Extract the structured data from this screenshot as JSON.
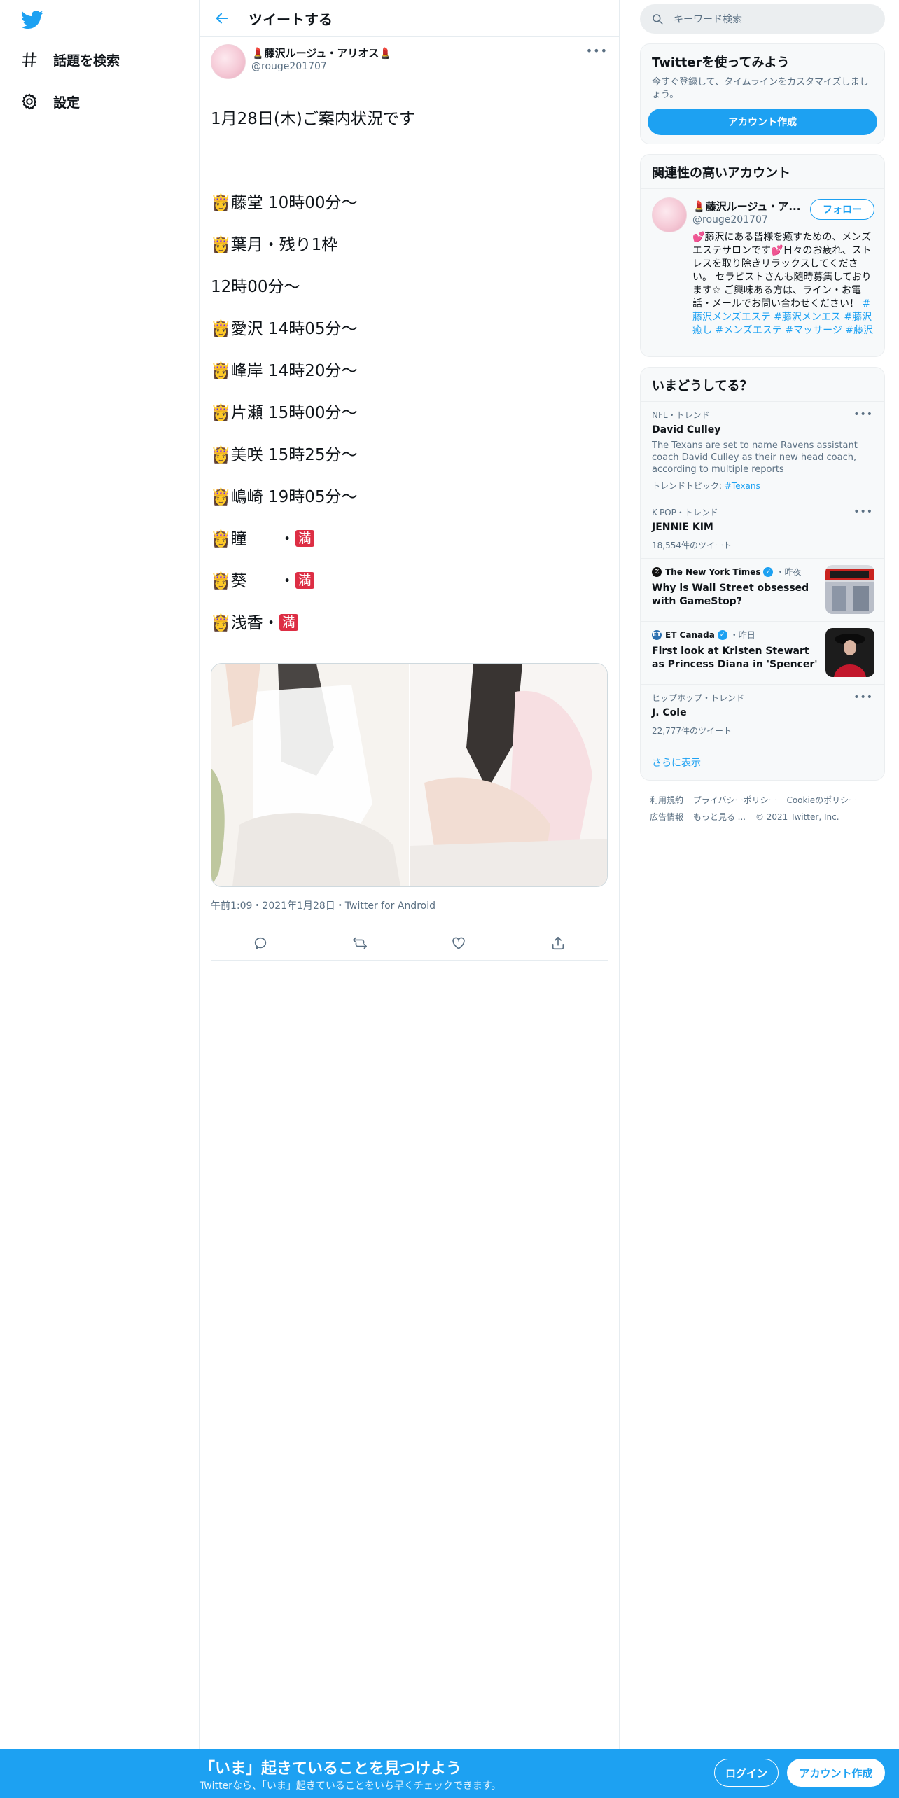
{
  "nav": {
    "items": [
      {
        "label": "話題を検索",
        "icon": "hashtag-icon"
      },
      {
        "label": "設定",
        "icon": "gear-icon"
      }
    ]
  },
  "main": {
    "title": "ツイートする"
  },
  "tweet": {
    "author_name": "💄藤沢ルージュ・アリオス💄",
    "author_handle": "@rouge201707",
    "lines": [
      "1月28日(木)ご案内状況です",
      "",
      "👸藤堂 10時00分～",
      "👸葉月・残り1枠",
      "12時00分～",
      "👸愛沢 14時05分～",
      "👸峰岸 14時20分～",
      "👸片瀬 15時00分～",
      "👸美咲 15時25分～",
      "👸嶋崎 19時05分～"
    ],
    "full_lines": [
      {
        "name": "👸瞳　　・",
        "badge": "満"
      },
      {
        "name": "👸葵　　・",
        "badge": "満"
      },
      {
        "name": "👸浅香・",
        "badge": "満"
      }
    ],
    "meta": "午前1:09・2021年1月28日・Twitter for Android"
  },
  "right": {
    "search_placeholder": "キーワード検索",
    "signup_card": {
      "title": "Twitterを使ってみよう",
      "desc": "今すぐ登録して、タイムラインをカスタマイズしましょう。",
      "button": "アカウント作成"
    },
    "related": {
      "title": "関連性の高いアカウント",
      "name": "💄藤沢ルージュ・ア...",
      "handle": "@rouge201707",
      "follow": "フォロー",
      "bio": "💕藤沢にある皆様を癒すための、メンズエステサロンです💕日々のお疲れ、ストレスを取り除きリラックスしてください。 セラピストさんも随時募集しております☆ ご興味ある方は、ライン・お電話・メールでお問い合わせください！",
      "bio_tags": "#藤沢メンズエステ #藤沢メンエス #藤沢癒し #メンズエステ #マッサージ #藤沢"
    },
    "trends": {
      "title": "いまどうしてる？",
      "nfl": {
        "context": "NFL・トレンド",
        "name": "David Culley",
        "desc": "The Texans are set to name Ravens assistant coach David Culley as their new head coach, according to multiple reports",
        "topic_label": "トレンドトピック: ",
        "topic_tag": "#Texans"
      },
      "kpop": {
        "context": "K-POP・トレンド",
        "name": "JENNIE KIM",
        "count": "18,554件のツイート"
      },
      "news1": {
        "source": "The New York Times",
        "time": "・昨夜",
        "title": "Why is Wall Street obsessed with GameStop?"
      },
      "news2": {
        "source": "ET Canada",
        "time": "・昨日",
        "title": "First look at Kristen Stewart as Princess Diana in 'Spencer'"
      },
      "hiphop": {
        "context": "ヒップホップ・トレンド",
        "name": "J. Cole",
        "count": "22,777件のツイート"
      },
      "show_more": "さらに表示"
    },
    "footer": [
      "利用規約",
      "プライバシーポリシー",
      "Cookieのポリシー",
      "広告情報",
      "もっと見る ...",
      "© 2021 Twitter, Inc."
    ]
  },
  "bottom_bar": {
    "title": "「いま」起きていることを見つけよう",
    "subtitle": "Twitterなら、「いま」起きていることをいち早くチェックできます。",
    "login": "ログイン",
    "signup": "アカウント作成"
  },
  "colors": {
    "accent": "#1da1f2",
    "badge_red": "#dd2e44",
    "text_secondary": "#5b7083"
  }
}
